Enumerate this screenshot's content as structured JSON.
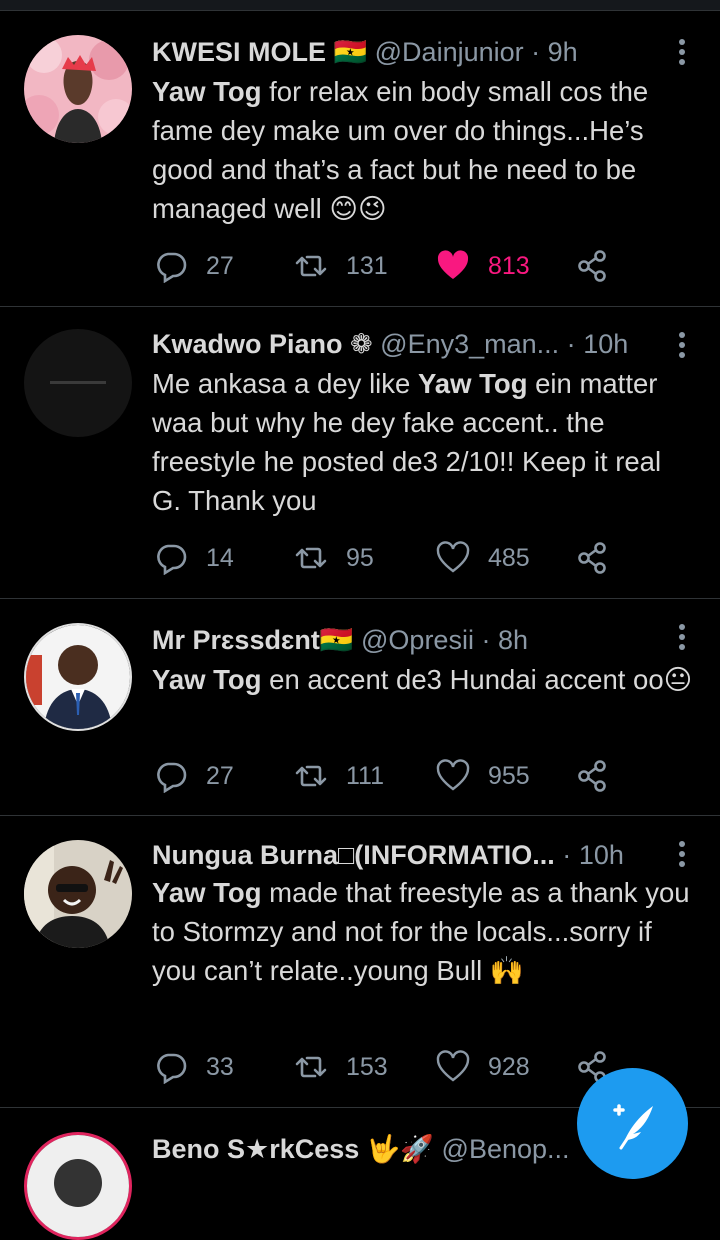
{
  "tweets": [
    {
      "name": "KWESI MOLE 🇬🇭",
      "handle": "@Dainjunior",
      "dot": "·",
      "time": "9h",
      "text_bold": "Yaw Tog",
      "text": " for relax ein body small cos the fame dey make um over do things...He’s good and that’s a fact but he need to be managed well 😊😉",
      "replies": "27",
      "retweets": "131",
      "likes": "813",
      "liked": true
    },
    {
      "name": "Kwadwo Piano ❁",
      "handle": "@Eny3_man...",
      "dot": "·",
      "time": "10h",
      "text_prefix": "Me ankasa a dey like ",
      "text_bold": "Yaw Tog",
      "text": " ein matter waa but why he dey fake accent.. the freestyle he posted de3 2/10!! Keep it real G. Thank you",
      "replies": "14",
      "retweets": "95",
      "likes": "485",
      "liked": false
    },
    {
      "name": "Mr Prɛssdɛnt🇬🇭",
      "handle": "@Opresii",
      "dot": "·",
      "time": "8h",
      "text_bold": "Yaw Tog",
      "text": " en accent de3 Hundai accent oo😐",
      "replies": "27",
      "retweets": "111",
      "likes": "955",
      "liked": false
    },
    {
      "name": "Nungua Burna□(INFORMATIO...",
      "handle": "",
      "dot": "·",
      "time": "10h",
      "text_bold": "Yaw Tog",
      "text": " made that freestyle as a thank you to Stormzy and not for the locals...sorry if you can’t relate..young Bull 🙌",
      "replies": "33",
      "retweets": "153",
      "likes": "928",
      "liked": false
    },
    {
      "name": "Beno S★rkCess 🤟🚀",
      "handle": "@Benop...",
      "dot": "",
      "time": ""
    }
  ],
  "icons": {
    "reply": "reply-icon",
    "retweet": "retweet-icon",
    "like": "heart-icon",
    "share": "share-icon",
    "compose": "compose-tweet-icon"
  },
  "colors": {
    "background": "#000000",
    "text": "#d9d9d9",
    "muted": "#8b98a5",
    "like": "#f91880",
    "accent": "#1d9bf0"
  }
}
